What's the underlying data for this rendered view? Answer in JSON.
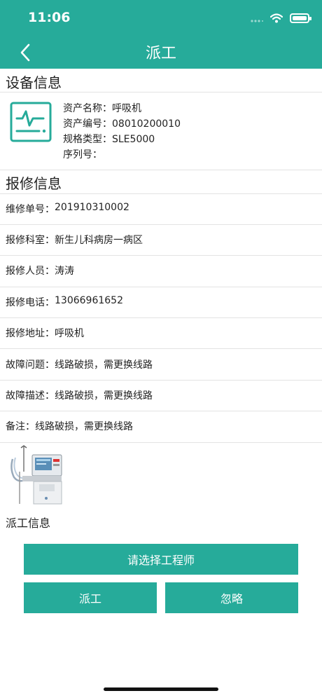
{
  "status_bar": {
    "time": "11:06"
  },
  "nav": {
    "title": "派工",
    "back_icon": "chevron-left-icon"
  },
  "device_section": {
    "title": "设备信息",
    "icon": "monitor-heartbeat-icon",
    "fields": [
      {
        "label": "资产名称：",
        "value": "呼吸机"
      },
      {
        "label": "资产编号：",
        "value": "08010200010"
      },
      {
        "label": "规格类型：",
        "value": "SLE5000"
      },
      {
        "label": "序列号：",
        "value": ""
      }
    ]
  },
  "repair_section": {
    "title": "报修信息",
    "fields": [
      {
        "label": "维修单号：",
        "value": "201910310002"
      },
      {
        "label": "报修科室：",
        "value": "新生儿科病房一病区"
      },
      {
        "label": "报修人员：",
        "value": "涛涛"
      },
      {
        "label": "报修电话：",
        "value": "13066961652"
      },
      {
        "label": "报修地址：",
        "value": "呼吸机"
      },
      {
        "label": "故障问题：",
        "value": "线路破损，需更换线路"
      },
      {
        "label": "故障描述：",
        "value": "线路破损，需更换线路"
      },
      {
        "label": "备注：",
        "value": "线路破损，需更换线路"
      }
    ]
  },
  "assign_section": {
    "title": "派工信息"
  },
  "buttons": {
    "select_engineer": "请选择工程师",
    "dispatch": "派工",
    "ignore": "忽略"
  },
  "colors": {
    "accent": "#26ab9a"
  }
}
